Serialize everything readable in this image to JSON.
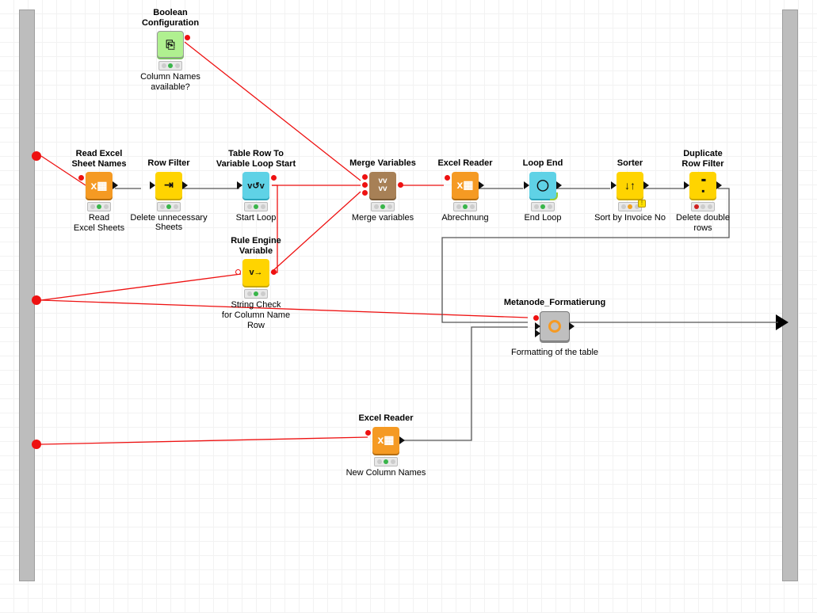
{
  "endpoints": {
    "left_ports": 3
  },
  "nodes": {
    "boolCfg": {
      "title": "Boolean\nConfiguration",
      "caption": "Column Names\navailable?",
      "status": "green"
    },
    "readSheets": {
      "title": "Read Excel\nSheet Names",
      "caption": "Read\nExcel Sheets",
      "status": "green"
    },
    "rowFilter": {
      "title": "Row Filter",
      "caption": "Delete unnecessary\nSheets",
      "status": "green"
    },
    "loopStart": {
      "title": "Table Row To\nVariable Loop Start",
      "caption": "Start Loop",
      "status": "green"
    },
    "ruleEngine": {
      "title": "Rule Engine\nVariable",
      "caption": "String Check\nfor Column Name Row",
      "status": "green"
    },
    "mergeVars": {
      "title": "Merge Variables",
      "caption": "Merge variables",
      "status": "green"
    },
    "excelReader1": {
      "title": "Excel Reader",
      "caption": "Abrechnung",
      "status": "green"
    },
    "loopEnd": {
      "title": "Loop End",
      "caption": "End Loop",
      "status": "green"
    },
    "sorter": {
      "title": "Sorter",
      "caption": "Sort by Invoice No",
      "status": "amber"
    },
    "dupFilter": {
      "title": "Duplicate\nRow Filter",
      "caption": "Delete double\nrows",
      "status": "red"
    },
    "metanode": {
      "title": "Metanode_Formatierung",
      "caption": "Formatting of the table",
      "status": null
    },
    "excelReader2": {
      "title": "Excel Reader",
      "caption": "New Column Names",
      "status": "green"
    }
  }
}
